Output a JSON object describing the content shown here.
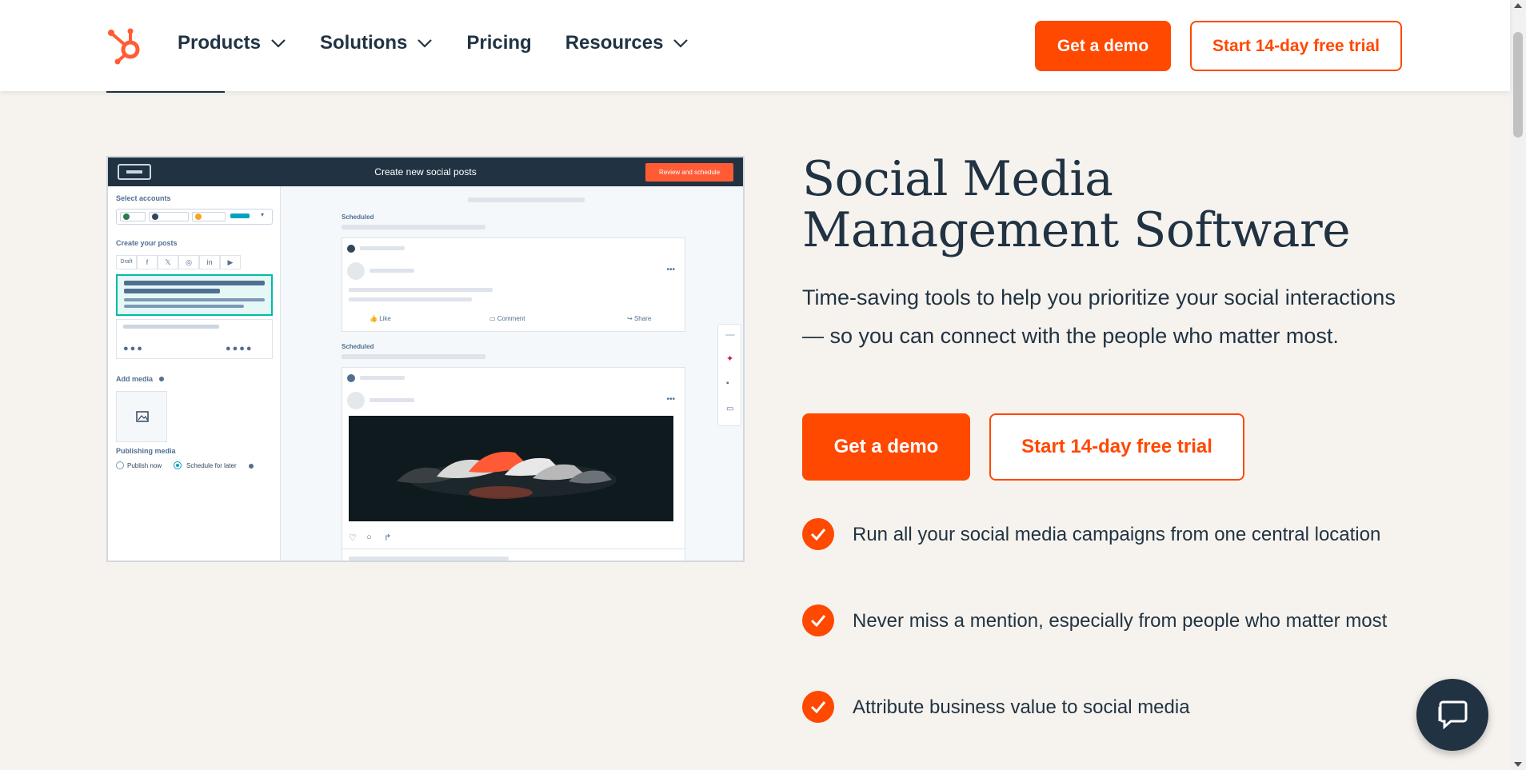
{
  "header": {
    "nav": [
      {
        "label": "Products",
        "has_dropdown": true
      },
      {
        "label": "Solutions",
        "has_dropdown": true
      },
      {
        "label": "Pricing",
        "has_dropdown": false
      },
      {
        "label": "Resources",
        "has_dropdown": true
      }
    ],
    "demo_button": "Get a demo",
    "trial_button": "Start 14-day free trial"
  },
  "screenshot": {
    "title": "Create new social posts",
    "review_button": "Review and schedule",
    "select_accounts": "Select accounts",
    "create_posts": "Create your posts",
    "draft_tab": "Draft",
    "tabs": [
      "f",
      "𝕏",
      "◎",
      "in",
      "▶"
    ],
    "add_media": "Add media",
    "publishing_media": "Publishing media",
    "publish_now": "Publish now",
    "schedule_later": "Schedule for later",
    "scheduled_1": "Scheduled",
    "scheduled_2": "Scheduled",
    "like": "Like",
    "comment": "Comment",
    "share": "Share",
    "more": "•••"
  },
  "hero": {
    "title": "Social Media Management Software",
    "subtitle": "Time-saving tools to help you prioritize your social interactions — so you can connect with the people who matter most.",
    "demo_button": "Get a demo",
    "trial_button": "Start 14-day free trial"
  },
  "features": [
    "Run all your social media campaigns from one central location",
    "Never miss a mention, especially from people who matter most",
    "Attribute business value to social media"
  ],
  "colors": {
    "accent": "#ff4800",
    "text": "#213343",
    "background": "#f6f3ee"
  },
  "icons": [
    "hubspot-logo-icon",
    "chevron-down-icon",
    "check-icon",
    "chat-icon"
  ]
}
